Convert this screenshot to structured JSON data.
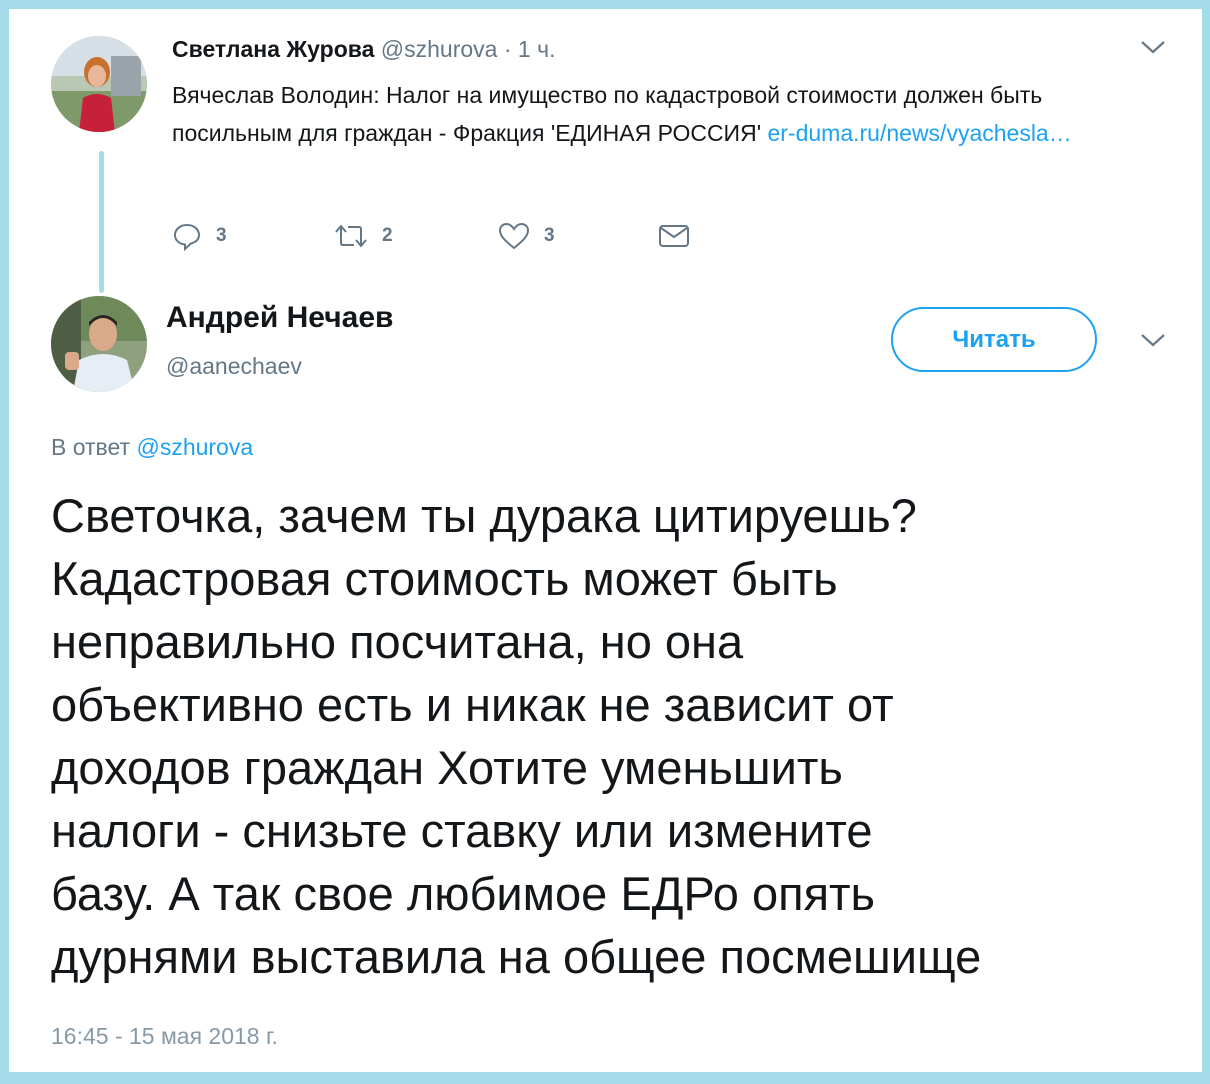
{
  "parent_tweet": {
    "author_name": "Светлана Журова",
    "author_handle": "@szhurova",
    "separator": "·",
    "time": "1 ч.",
    "text": "Вячеслав Володин: Налог на имущество по кадастровой стоимости должен быть посильным для граждан - Фракция 'ЕДИНАЯ РОССИЯ' ",
    "link_text": "er-duma.ru/news/vyachesla…",
    "replies": "3",
    "retweets": "2",
    "likes": "3"
  },
  "reply_tweet": {
    "author_name": "Андрей Нечаев",
    "author_handle": "@aanechaev",
    "follow_label": "Читать",
    "in_reply_prefix": "В ответ ",
    "in_reply_handle": "@szhurova",
    "text": "Светочка, зачем ты дурака цитируешь?\nКадастровая стоимость может быть\nнеправильно посчитана, но она\nобъективно есть и никак не зависит от\nдоходов граждан Хотите уменьшить\nналоги - снизьте ставку или измените\nбазу. А так свое любимое ЕДРо опять\nдурнями выставила на общее посмешище",
    "timestamp": "16:45 - 15 мая 2018 г."
  },
  "colors": {
    "frame": "#a5dcea",
    "accent": "#1da1f2",
    "muted": "#657786",
    "text": "#14171a"
  },
  "icons": [
    "chevron-down-icon",
    "reply-icon",
    "retweet-icon",
    "like-icon",
    "direct-message-icon"
  ]
}
